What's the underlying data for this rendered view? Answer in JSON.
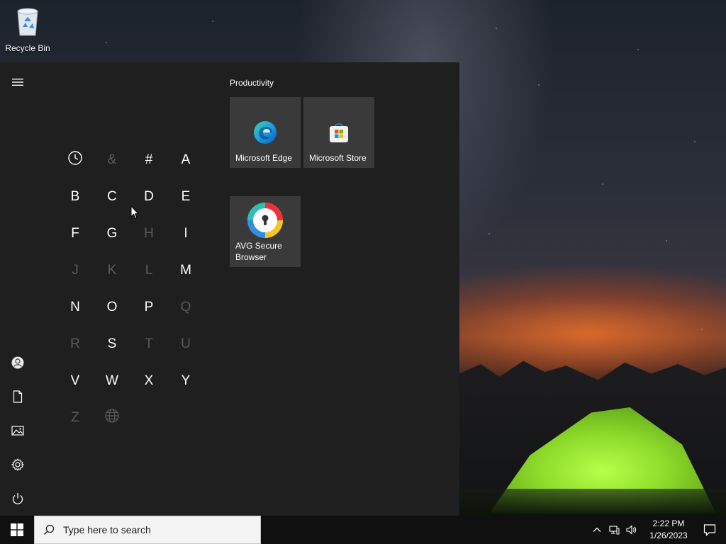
{
  "desktop": {
    "recycle_bin_label": "Recycle Bin",
    "icon": "recycle-bin-icon"
  },
  "start_menu": {
    "rail": [
      {
        "name": "menu",
        "icon": "hamburger-menu-icon"
      },
      {
        "name": "user",
        "icon": "user-account-icon"
      },
      {
        "name": "documents",
        "icon": "document-icon"
      },
      {
        "name": "pictures",
        "icon": "pictures-icon"
      },
      {
        "name": "settings",
        "icon": "gear-icon"
      },
      {
        "name": "power",
        "icon": "power-icon"
      }
    ],
    "letters": [
      {
        "label": "",
        "icon": "clock-icon",
        "enabled": true
      },
      {
        "label": "&",
        "enabled": false
      },
      {
        "label": "#",
        "enabled": true
      },
      {
        "label": "A",
        "enabled": true
      },
      {
        "label": "B",
        "enabled": true
      },
      {
        "label": "C",
        "enabled": true
      },
      {
        "label": "D",
        "enabled": true
      },
      {
        "label": "E",
        "enabled": true
      },
      {
        "label": "F",
        "enabled": true
      },
      {
        "label": "G",
        "enabled": true
      },
      {
        "label": "H",
        "enabled": false
      },
      {
        "label": "I",
        "enabled": true
      },
      {
        "label": "J",
        "enabled": false
      },
      {
        "label": "K",
        "enabled": false
      },
      {
        "label": "L",
        "enabled": false
      },
      {
        "label": "M",
        "enabled": true
      },
      {
        "label": "N",
        "enabled": true
      },
      {
        "label": "O",
        "enabled": true
      },
      {
        "label": "P",
        "enabled": true
      },
      {
        "label": "Q",
        "enabled": false
      },
      {
        "label": "R",
        "enabled": false
      },
      {
        "label": "S",
        "enabled": true
      },
      {
        "label": "T",
        "enabled": false
      },
      {
        "label": "U",
        "enabled": false
      },
      {
        "label": "V",
        "enabled": true
      },
      {
        "label": "W",
        "enabled": true
      },
      {
        "label": "X",
        "enabled": true
      },
      {
        "label": "Y",
        "enabled": true
      },
      {
        "label": "Z",
        "enabled": false
      },
      {
        "label": "",
        "icon": "globe-icon",
        "enabled": false
      }
    ],
    "group_title": "Productivity",
    "tiles": [
      {
        "label": "Microsoft Edge",
        "icon": "edge-icon"
      },
      {
        "label": "Microsoft Store",
        "icon": "store-icon"
      },
      {
        "label": "AVG Secure Browser",
        "icon": "avg-secure-browser-icon"
      }
    ]
  },
  "taskbar": {
    "start_icon": "windows-logo-icon",
    "search_placeholder": "Type here to search",
    "tray_icons": [
      "chevron-up-icon",
      "network-icon",
      "volume-icon"
    ],
    "time": "2:22 PM",
    "date": "1/26/2023",
    "notification_icon": "notification-icon"
  },
  "colors": {
    "start_bg": "#1f1f1f",
    "tile_bg": "#3a3a3a",
    "taskbar_bg": "#101010",
    "dim_letter": "#5a5a5a"
  }
}
